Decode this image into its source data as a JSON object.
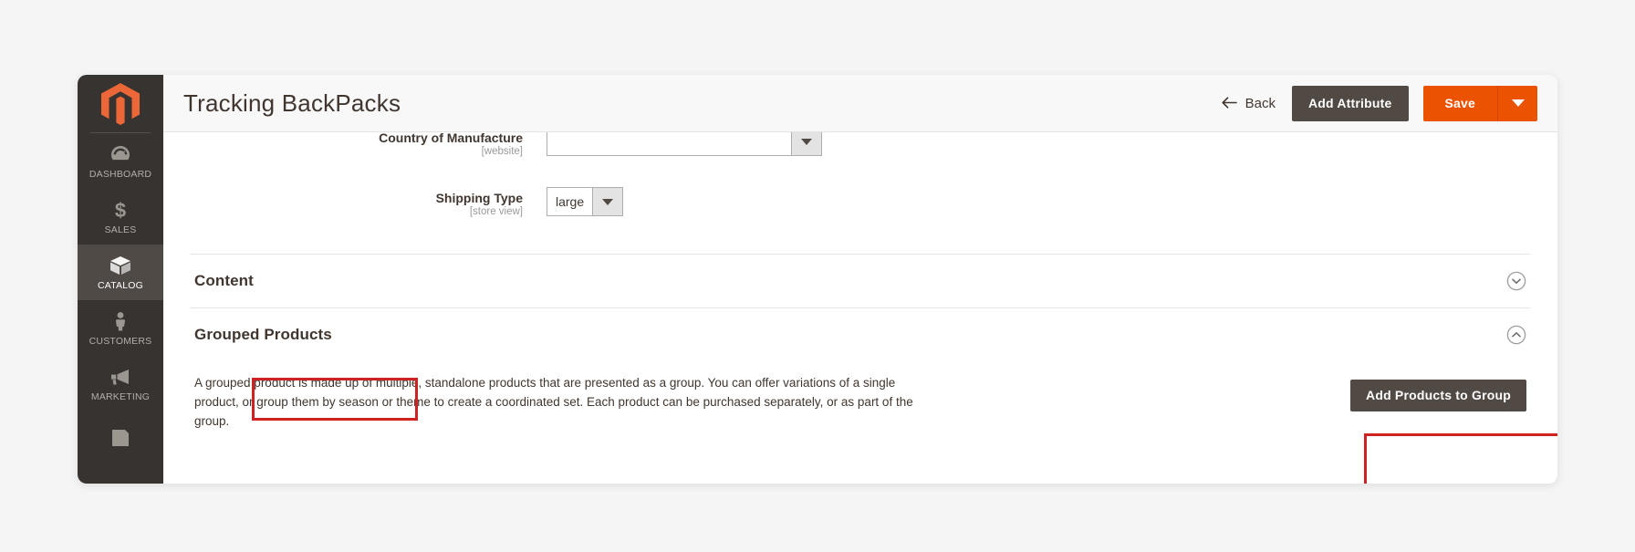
{
  "app": {
    "brand_icon": "magento-logo-icon",
    "accent_color": "#eb5202",
    "sidebar_bg": "#373330",
    "annotation_color": "#cf2323"
  },
  "sidebar": {
    "items": [
      {
        "label": "DASHBOARD",
        "icon": "dashboard-gauge-icon",
        "active": false
      },
      {
        "label": "SALES",
        "icon": "dollar-sign-icon",
        "active": false
      },
      {
        "label": "CATALOG",
        "icon": "box-package-icon",
        "active": true
      },
      {
        "label": "CUSTOMERS",
        "icon": "person-icon",
        "active": false
      },
      {
        "label": "MARKETING",
        "icon": "megaphone-icon",
        "active": false
      },
      {
        "label": "",
        "icon": "content-pages-icon",
        "active": false
      }
    ]
  },
  "header": {
    "title": "Tracking BackPacks",
    "back_label": "Back",
    "back_icon": "arrow-left-icon",
    "add_attribute_label": "Add Attribute",
    "save_label": "Save",
    "save_dropdown_icon": "caret-down-icon"
  },
  "form": {
    "fields": [
      {
        "label": "Country of Manufacture",
        "scope": "[website]",
        "value": "",
        "control": "select"
      },
      {
        "label": "Shipping Type",
        "scope": "[store view]",
        "value": "large",
        "control": "select"
      }
    ]
  },
  "sections": [
    {
      "title": "Content",
      "expanded": false,
      "toggle_icon": "chevron-down-circle-icon"
    },
    {
      "title": "Grouped Products",
      "expanded": true,
      "toggle_icon": "chevron-up-circle-icon",
      "description": "A grouped product is made up of multiple, standalone products that are presented as a group. You can offer variations of a single product, or group them by season or theme to create a coordinated set. Each product can be purchased separately, or as part of the group.",
      "action_label": "Add Products to Group"
    }
  ]
}
